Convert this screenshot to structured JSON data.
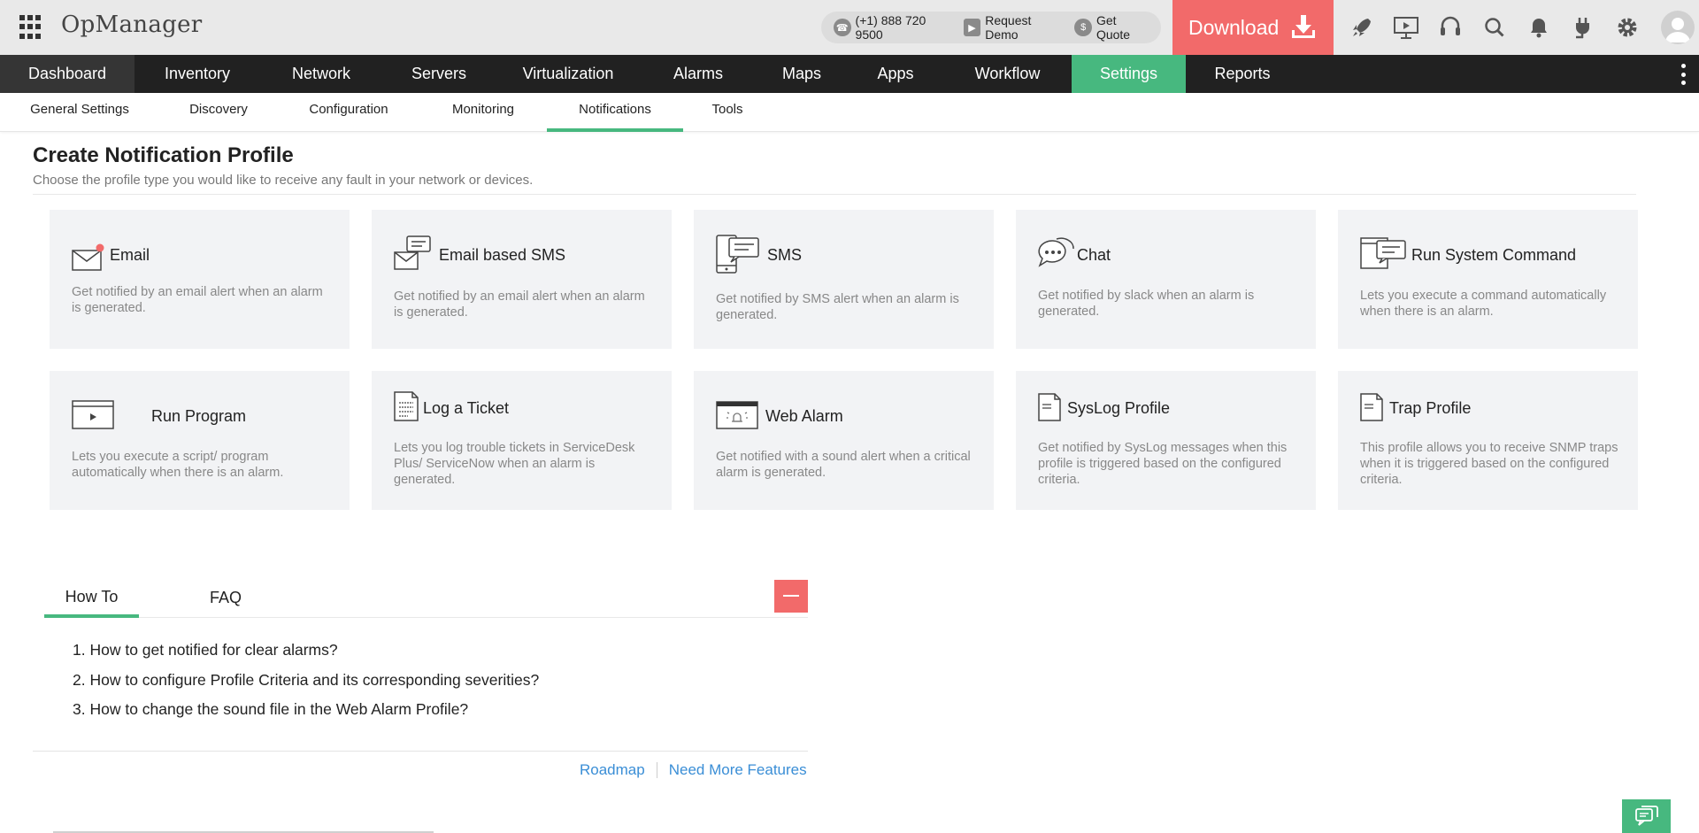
{
  "app": {
    "title": "OpManager",
    "phone": "(+1) 888 720 9500",
    "request_demo": "Request Demo",
    "get_quote": "Get Quote",
    "download": "Download",
    "top_icons": [
      "rocket-icon",
      "presentation-icon",
      "headset-icon",
      "search-icon",
      "bell-icon",
      "plug-icon",
      "gear-icon"
    ]
  },
  "main_nav": [
    {
      "label": "Dashboard"
    },
    {
      "label": "Inventory"
    },
    {
      "label": "Network"
    },
    {
      "label": "Servers"
    },
    {
      "label": "Virtualization"
    },
    {
      "label": "Alarms"
    },
    {
      "label": "Maps"
    },
    {
      "label": "Apps"
    },
    {
      "label": "Workflow"
    },
    {
      "label": "Settings",
      "active": true
    },
    {
      "label": "Reports"
    }
  ],
  "sub_nav": [
    {
      "label": "General Settings"
    },
    {
      "label": "Discovery"
    },
    {
      "label": "Configuration"
    },
    {
      "label": "Monitoring"
    },
    {
      "label": "Notifications",
      "active": true
    },
    {
      "label": "Tools"
    }
  ],
  "page": {
    "title": "Create Notification Profile",
    "subtitle": "Choose the profile type you would like to receive any fault in your network or devices."
  },
  "profiles": [
    {
      "title": "Email",
      "desc": "Get notified by an email alert when an alarm is generated.",
      "icon": "envelope-icon"
    },
    {
      "title": "Email based SMS",
      "desc": "Get notified by an email alert when an alarm is generated.",
      "icon": "email-sms-icon"
    },
    {
      "title": "SMS",
      "desc": "Get notified by SMS alert when an alarm is generated.",
      "icon": "mobile-message-icon"
    },
    {
      "title": "Chat",
      "desc": "Get notified by slack when an alarm is generated.",
      "icon": "chat-bubble-icon"
    },
    {
      "title": "Run System Command",
      "desc": "Lets you execute a command automatically when there is an alarm.",
      "icon": "monitor-command-icon"
    },
    {
      "title": "Run Program",
      "desc": "Lets you execute a script/ program automatically when there is an alarm.",
      "icon": "program-window-icon"
    },
    {
      "title": "Log a Ticket",
      "desc": "Lets you log trouble tickets in ServiceDesk Plus/ ServiceNow when an alarm is generated.",
      "icon": "ticket-document-icon"
    },
    {
      "title": "Web Alarm",
      "desc": "Get notified with a sound alert when a critical alarm is generated.",
      "icon": "browser-alarm-icon"
    },
    {
      "title": "SysLog Profile",
      "desc": "Get notified by SysLog messages when this profile is triggered based on the configured criteria.",
      "icon": "syslog-document-icon"
    },
    {
      "title": "Trap Profile",
      "desc": "This profile allows you to receive SNMP traps when it is triggered based on the configured criteria.",
      "icon": "trap-document-icon"
    }
  ],
  "help": {
    "tabs": [
      {
        "label": "How To",
        "active": true
      },
      {
        "label": "FAQ"
      }
    ],
    "items": [
      "1. How to get notified for clear alarms?",
      "2. How to configure Profile Criteria and its corresponding severities?",
      "3. How to change the sound file in the Web Alarm Profile?"
    ],
    "links": {
      "roadmap": "Roadmap",
      "more_features": "Need More Features"
    }
  },
  "colors": {
    "accent": "#47b87f",
    "download": "#f26a6a",
    "nav_bg": "#212121",
    "link": "#3a8ed6"
  }
}
